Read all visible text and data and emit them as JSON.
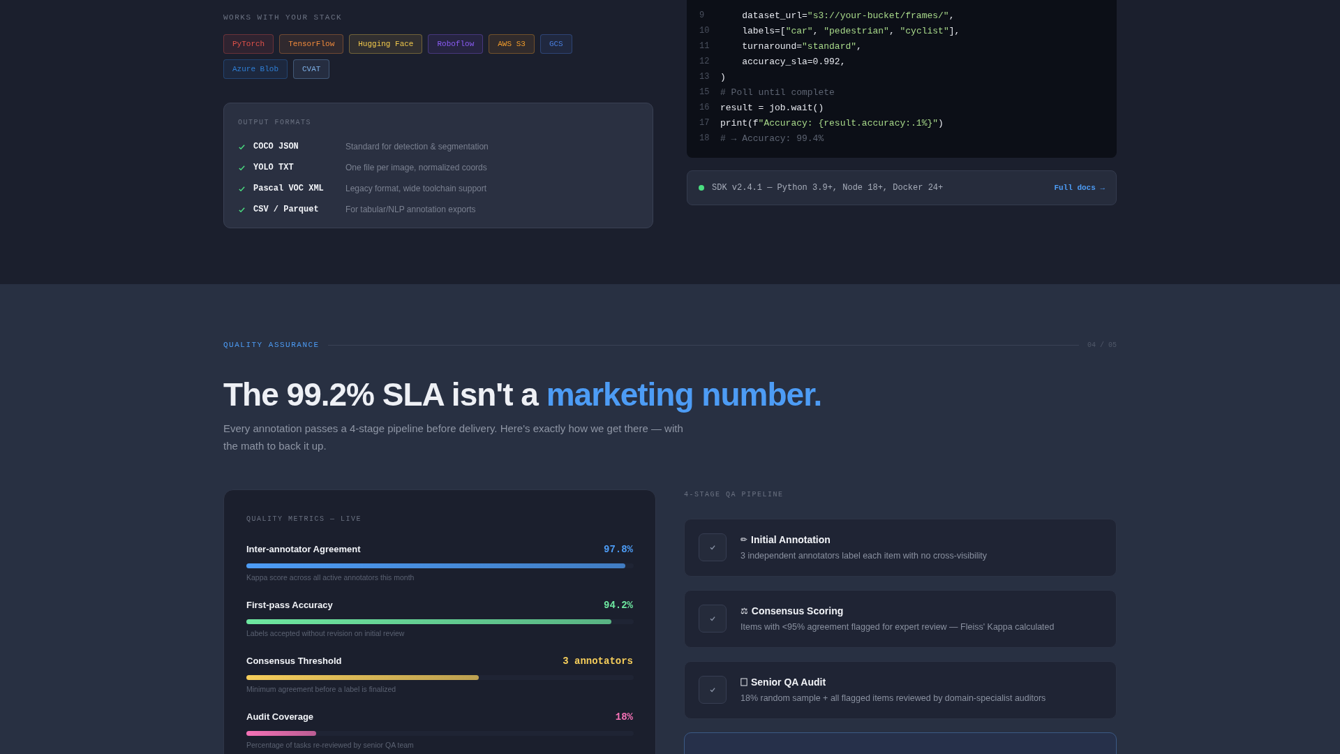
{
  "stack": {
    "label": "WORKS WITH YOUR STACK",
    "tags": [
      {
        "label": "PyTorch",
        "color": "#e0524a"
      },
      {
        "label": "TensorFlow",
        "color": "#f08a3c"
      },
      {
        "label": "Hugging Face",
        "color": "#f2c94c"
      },
      {
        "label": "Roboflow",
        "color": "#8b5cf6"
      },
      {
        "label": "AWS S3",
        "color": "#f59e2b"
      },
      {
        "label": "GCS",
        "color": "#4a7fe0"
      },
      {
        "label": "Azure Blob",
        "color": "#2f7fd6"
      },
      {
        "label": "CVAT",
        "color": "#7fb2e8"
      }
    ]
  },
  "output_formats": {
    "label": "OUTPUT FORMATS",
    "items": [
      {
        "name": "COCO JSON",
        "description": "Standard for detection & segmentation",
        "checked": true
      },
      {
        "name": "YOLO TXT",
        "description": "One file per image, normalized coords",
        "checked": true
      },
      {
        "name": "Pascal VOC XML",
        "description": "Legacy format, wide toolchain support",
        "checked": true
      },
      {
        "name": "CSV / Parquet",
        "description": "For tabular/NLP annotation exports",
        "checked": true
      }
    ]
  },
  "code": {
    "lines": [
      {
        "number": "9",
        "tokens": [
          {
            "text": "    dataset_url=",
            "kind": "plain"
          },
          {
            "text": "\"s3://your-bucket/frames/\"",
            "kind": "string"
          },
          {
            "text": ",",
            "kind": "plain"
          }
        ]
      },
      {
        "number": "10",
        "tokens": [
          {
            "text": "    labels=[",
            "kind": "plain"
          },
          {
            "text": "\"car\"",
            "kind": "string"
          },
          {
            "text": ", ",
            "kind": "plain"
          },
          {
            "text": "\"pedestrian\"",
            "kind": "string"
          },
          {
            "text": ", ",
            "kind": "plain"
          },
          {
            "text": "\"cyclist\"",
            "kind": "string"
          },
          {
            "text": "],",
            "kind": "plain"
          }
        ]
      },
      {
        "number": "11",
        "tokens": [
          {
            "text": "    turnaround=",
            "kind": "plain"
          },
          {
            "text": "\"standard\"",
            "kind": "string"
          },
          {
            "text": ",",
            "kind": "plain"
          }
        ]
      },
      {
        "number": "12",
        "tokens": [
          {
            "text": "    accuracy_sla=0.992,",
            "kind": "plain"
          }
        ]
      },
      {
        "number": "13",
        "tokens": [
          {
            "text": ")",
            "kind": "plain"
          }
        ]
      },
      {
        "number": "15",
        "tokens": [
          {
            "text": "# Poll until complete",
            "kind": "comment"
          }
        ]
      },
      {
        "number": "16",
        "tokens": [
          {
            "text": "result = job.wait()",
            "kind": "plain"
          }
        ]
      },
      {
        "number": "17",
        "tokens": [
          {
            "text": "print(f",
            "kind": "plain"
          },
          {
            "text": "\"Accuracy: {result.accuracy:.1%}\"",
            "kind": "string"
          },
          {
            "text": ")",
            "kind": "plain"
          }
        ]
      },
      {
        "number": "18",
        "tokens": [
          {
            "text": "# → Accuracy: 99.4%",
            "kind": "comment"
          }
        ]
      }
    ]
  },
  "sdk_bar": {
    "online": true,
    "text": "SDK v2.4.1 — Python 3.9+, Node 18+, Docker 24+",
    "link": "Full docs →"
  },
  "section": {
    "eyebrow": "QUALITY ASSURANCE",
    "counter": "04 / 05",
    "headline": "The 99.2% SLA isn't a",
    "headline_accent": "marketing number.",
    "intro": "Every annotation passes a 4-stage pipeline before delivery. Here's exactly how we get there — with the math to back it up."
  },
  "metrics": {
    "label": "QUALITY METRICS — LIVE",
    "items": [
      {
        "name": "Inter-annotator Agreement",
        "value": "97.8%",
        "level": 0.978,
        "color": "#4d9cf5",
        "note": "Kappa score across all active annotators this month"
      },
      {
        "name": "First-pass Accuracy",
        "value": "94.2%",
        "level": 0.942,
        "color": "#6ee7a0",
        "note": "Labels accepted without revision on initial review"
      },
      {
        "name": "Consensus Threshold",
        "value": "3 annotators",
        "level": 0.6,
        "color": "#f5cd5b",
        "note": "Minimum agreement before a label is finalized"
      },
      {
        "name": "Audit Coverage",
        "value": "18%",
        "level": 0.18,
        "color": "#f472b6",
        "note": "Percentage of tasks re-reviewed by senior QA team"
      }
    ]
  },
  "pipeline": {
    "label": "4-STAGE QA PIPELINE",
    "steps": [
      {
        "glyph": "✏",
        "title": "Initial Annotation",
        "description": "3 independent annotators label each item with no cross-visibility",
        "done": true
      },
      {
        "glyph": "⚖",
        "title": "Consensus Scoring",
        "description": "Items with <95% agreement flagged for expert review — Fleiss' Kappa calculated",
        "done": true
      },
      {
        "title": "Senior QA Audit",
        "description": "18% random sample + all flagged items reviewed by domain-specialist auditors",
        "done": true
      }
    ],
    "partial_step": {
      "highlighted": true
    }
  }
}
